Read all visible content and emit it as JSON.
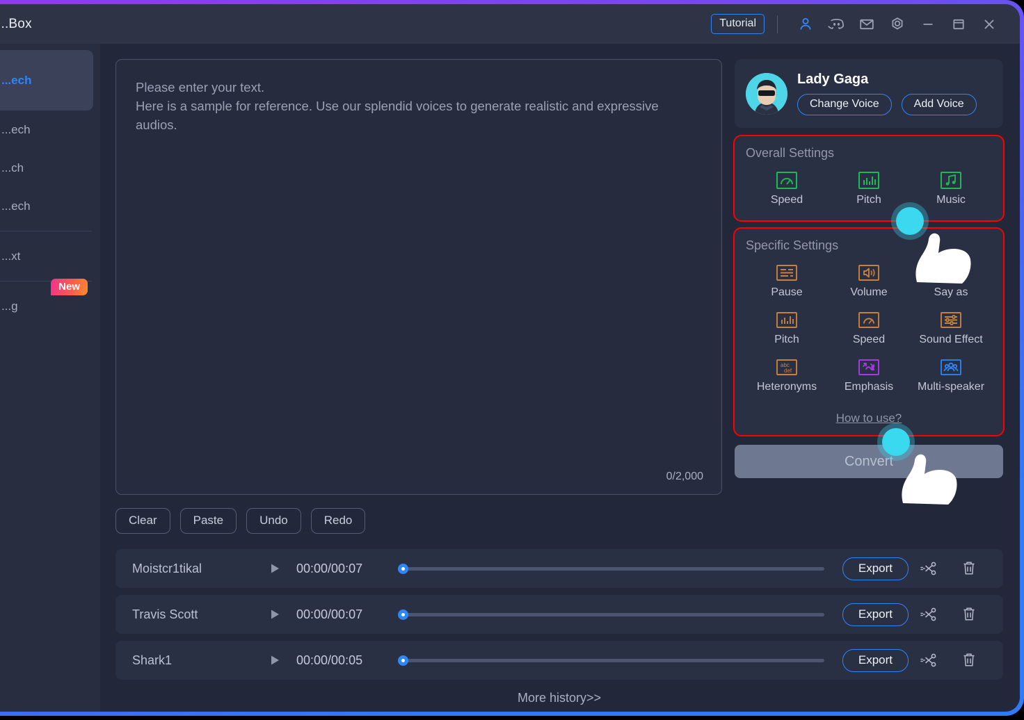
{
  "window": {
    "title": "...Box",
    "border_gradient_from": "#8b3cf0",
    "border_gradient_to": "#2f7bf5"
  },
  "titlebar": {
    "tutorial_label": "Tutorial",
    "icons": [
      {
        "name": "account-icon",
        "glyph": "person"
      },
      {
        "name": "discord-icon",
        "glyph": "discord"
      },
      {
        "name": "mail-icon",
        "glyph": "mail"
      },
      {
        "name": "settings-icon",
        "glyph": "gear"
      },
      {
        "name": "minimize-icon",
        "glyph": "minimize"
      },
      {
        "name": "maximize-icon",
        "glyph": "maximize"
      },
      {
        "name": "close-icon",
        "glyph": "close"
      }
    ]
  },
  "sidebar": {
    "items": [
      {
        "label": "...ech",
        "active": true,
        "badge": null
      },
      {
        "label": "...ech",
        "active": false,
        "badge": null
      },
      {
        "label": "...ch",
        "active": false,
        "badge": null
      },
      {
        "label": "...ech",
        "active": false,
        "badge": null
      },
      {
        "label": "...xt",
        "active": false,
        "badge": null
      },
      {
        "label": "...g",
        "active": false,
        "badge": "New"
      }
    ],
    "badge_new": "New"
  },
  "editor": {
    "placeholder_line1": "Please enter your text.",
    "placeholder_line2": "Here is a sample for reference. Use our splendid voices to generate realistic and expressive audios.",
    "value": "",
    "char_counter": "0/2,000",
    "tools": [
      {
        "label": "Clear",
        "name": "clear-button"
      },
      {
        "label": "Paste",
        "name": "paste-button"
      },
      {
        "label": "Undo",
        "name": "undo-button"
      },
      {
        "label": "Redo",
        "name": "redo-button"
      }
    ]
  },
  "voice": {
    "name": "Lady Gaga",
    "change_voice_label": "Change Voice",
    "add_voice_label": "Add Voice"
  },
  "overall_settings": {
    "title": "Overall Settings",
    "highlight_color": "#ff0000",
    "icon_color": "#1fb954",
    "items": [
      {
        "label": "Speed",
        "icon": "gauge-icon",
        "color": "#1fb954"
      },
      {
        "label": "Pitch",
        "icon": "bars-icon",
        "color": "#1fb954"
      },
      {
        "label": "Music",
        "icon": "music-note-icon",
        "color": "#1fb954"
      }
    ]
  },
  "specific_settings": {
    "title": "Specific Settings",
    "highlight_color": "#ff0000",
    "items": [
      {
        "label": "Pause",
        "icon": "pause-lines-icon",
        "color": "#c8803c"
      },
      {
        "label": "Volume",
        "icon": "volume-icon",
        "color": "#c8803c"
      },
      {
        "label": "Say as",
        "icon": "abc123-icon",
        "color": "#c8803c"
      },
      {
        "label": "Pitch",
        "icon": "bars-icon",
        "color": "#c8803c"
      },
      {
        "label": "Speed",
        "icon": "gauge-icon",
        "color": "#c8803c"
      },
      {
        "label": "Sound Effect",
        "icon": "sliders-icon",
        "color": "#c8803c"
      },
      {
        "label": "Heteronyms",
        "icon": "abcdef-icon",
        "color": "#c8803c"
      },
      {
        "label": "Emphasis",
        "icon": "arrows-icon",
        "color": "#a13ce0"
      },
      {
        "label": "Multi-speaker",
        "icon": "people-icon",
        "color": "#2f86f5"
      }
    ],
    "how_to_use_label": "How to use?"
  },
  "convert": {
    "label": "Convert",
    "disabled": true
  },
  "history": {
    "rows": [
      {
        "name": "Moistcr1tikal",
        "time": "00:00/00:07",
        "progress": 0,
        "export_label": "Export"
      },
      {
        "name": "Travis Scott",
        "time": "00:00/00:07",
        "progress": 0,
        "export_label": "Export"
      },
      {
        "name": "Shark1",
        "time": "00:00/00:05",
        "progress": 0,
        "export_label": "Export"
      }
    ],
    "more_label": "More history>>",
    "play_icon": "play-icon",
    "cut_icon": "scissors-icon",
    "delete_icon": "trash-icon"
  }
}
